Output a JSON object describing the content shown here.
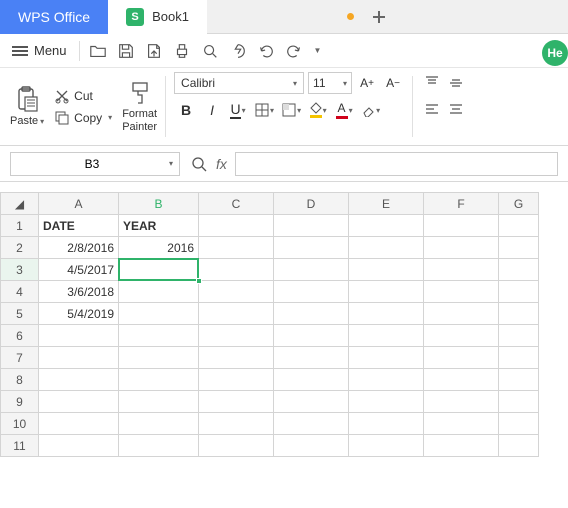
{
  "tabs": {
    "app": "WPS Office",
    "book": "Book1"
  },
  "menu": {
    "label": "Menu"
  },
  "help": {
    "label": "He"
  },
  "clipboard": {
    "paste": "Paste",
    "cut": "Cut",
    "copy": "Copy",
    "format_painter_l1": "Format",
    "format_painter_l2": "Painter"
  },
  "font": {
    "name": "Calibri",
    "size": "11",
    "inc": "A⁺",
    "dec": "A⁻",
    "bold": "B",
    "italic": "I",
    "underline": "U",
    "fill_color": "#f5c400",
    "text_color": "#d0021b"
  },
  "namebox": {
    "value": "B3"
  },
  "fx": {
    "label": "fx"
  },
  "grid": {
    "cols": [
      "A",
      "B",
      "C",
      "D",
      "E",
      "F",
      "G"
    ],
    "rows": [
      "1",
      "2",
      "3",
      "4",
      "5",
      "6",
      "7",
      "8",
      "9",
      "10",
      "11"
    ],
    "data": {
      "A1": "DATE",
      "B1": "YEAR",
      "A2": "2/8/2016",
      "B2": "2016",
      "A3": "4/5/2017",
      "A4": "3/6/2018",
      "A5": "5/4/2019"
    },
    "selected": "B3"
  }
}
